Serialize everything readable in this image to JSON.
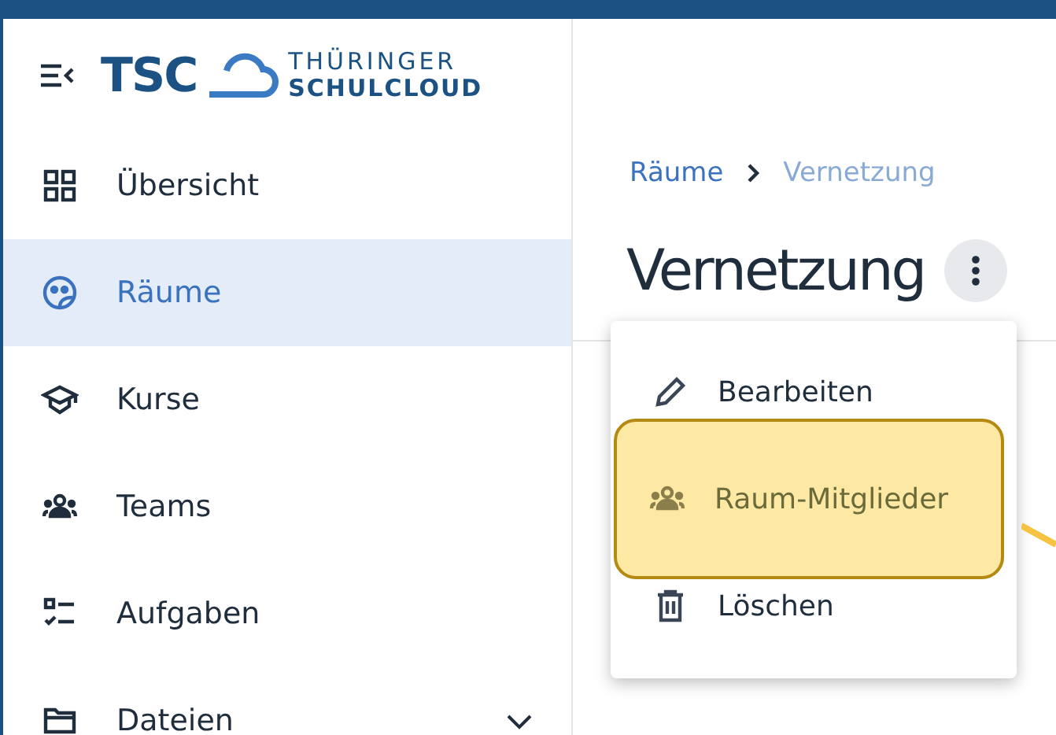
{
  "logo": {
    "short": "TSC",
    "line_1": "THÜRINGER",
    "line_2": "SCHULCLOUD"
  },
  "sidebar": {
    "items": [
      {
        "label": "Übersicht",
        "selected": false
      },
      {
        "label": "Räume",
        "selected": true
      },
      {
        "label": "Kurse",
        "selected": false
      },
      {
        "label": "Teams",
        "selected": false
      },
      {
        "label": "Aufgaben",
        "selected": false
      },
      {
        "label": "Dateien",
        "selected": false,
        "expanded": false
      }
    ]
  },
  "breadcrumb": [
    {
      "label": "Räume",
      "kind": "link"
    },
    {
      "label": "Vernetzung",
      "kind": "current"
    }
  ],
  "title": "Vernetzung",
  "menu": {
    "items": [
      {
        "label": "Bearbeiten",
        "highlighted": false
      },
      {
        "label": "Raum-Mitglieder",
        "highlighted": true
      },
      {
        "label": "Löschen",
        "highlighted": false
      }
    ]
  }
}
